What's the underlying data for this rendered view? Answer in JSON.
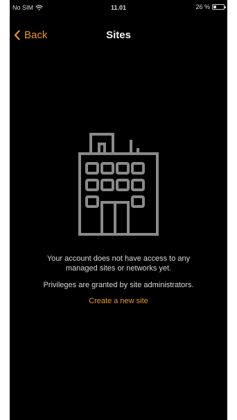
{
  "status_bar": {
    "carrier": "No SIM",
    "time": "11.01",
    "battery_text": "26 %",
    "battery_level": 0.26
  },
  "nav": {
    "back_label": "Back",
    "title": "Sites",
    "back_icon": "chevron-left-icon"
  },
  "empty_state": {
    "icon": "building-icon",
    "message": "Your account does not have access to any managed sites or networks yet.",
    "privileges": "Privileges are granted by site administrators.",
    "create_link": "Create a new site"
  },
  "colors": {
    "accent": "#e9952b",
    "background": "#000000",
    "icon": "#8a8a8a",
    "text": "#d9d9d9"
  }
}
